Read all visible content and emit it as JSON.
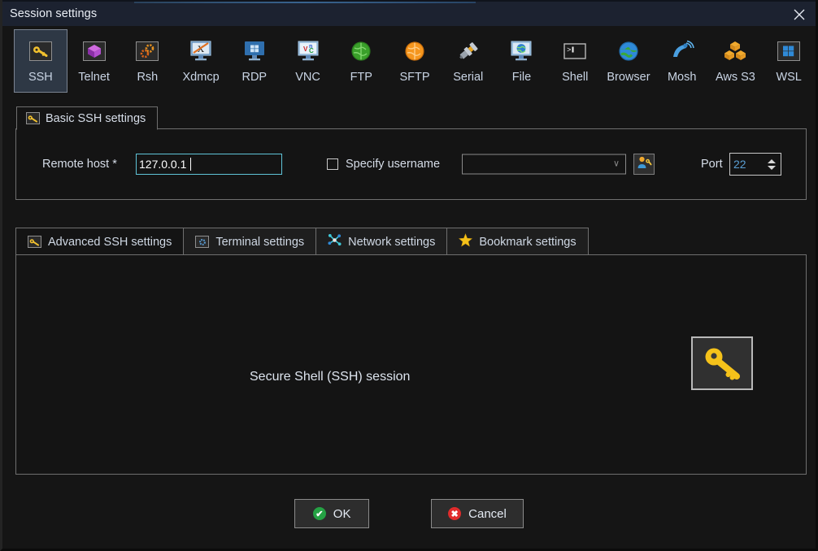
{
  "window": {
    "title": "Session settings",
    "close_label": "×",
    "accent_color": "#3d6fa0",
    "background": "#151515",
    "titlebar_background": "#1c2230"
  },
  "protocols": {
    "selected": "SSH",
    "items": [
      {
        "label": "SSH",
        "icon": "ssh-key-icon"
      },
      {
        "label": "Telnet",
        "icon": "telnet-cube-icon"
      },
      {
        "label": "Rsh",
        "icon": "rsh-gears-icon"
      },
      {
        "label": "Xdmcp",
        "icon": "xdmcp-monitor-icon"
      },
      {
        "label": "RDP",
        "icon": "rdp-windows-monitor-icon"
      },
      {
        "label": "VNC",
        "icon": "vnc-monitor-icon"
      },
      {
        "label": "FTP",
        "icon": "ftp-green-globe-icon"
      },
      {
        "label": "SFTP",
        "icon": "sftp-orange-globe-icon"
      },
      {
        "label": "Serial",
        "icon": "serial-connector-icon"
      },
      {
        "label": "File",
        "icon": "file-monitor-globe-icon"
      },
      {
        "label": "Shell",
        "icon": "shell-prompt-icon"
      },
      {
        "label": "Browser",
        "icon": "browser-globe-icon"
      },
      {
        "label": "Mosh",
        "icon": "mosh-satellite-icon"
      },
      {
        "label": "Aws S3",
        "icon": "aws-s3-cubes-icon"
      },
      {
        "label": "WSL",
        "icon": "wsl-windows-icon"
      }
    ]
  },
  "basic_settings": {
    "group_title": "Basic SSH settings",
    "group_icon": "ssh-key-icon",
    "remote_host_label": "Remote host *",
    "remote_host_value": "127.0.0.1",
    "remote_host_placeholder": "",
    "specify_username_label": "Specify username",
    "specify_username_checked": false,
    "username_value": "",
    "username_placeholder": "",
    "username_dropdown_arrow": "∨",
    "userkey_button_icon": "user-key-icon",
    "port_label": "Port",
    "port_value": "22"
  },
  "tabs": {
    "active": "Advanced SSH settings",
    "items": [
      {
        "label": "Advanced SSH settings",
        "icon": "ssh-key-icon"
      },
      {
        "label": "Terminal settings",
        "icon": "terminal-settings-icon"
      },
      {
        "label": "Network settings",
        "icon": "network-nodes-icon"
      },
      {
        "label": "Bookmark settings",
        "icon": "star-icon"
      }
    ]
  },
  "panel": {
    "caption": "Secure Shell (SSH) session",
    "icon": "ssh-key-large-icon"
  },
  "footer": {
    "ok_label": "OK",
    "cancel_label": "Cancel",
    "ok_badge": "✔",
    "cancel_badge": "✖"
  }
}
